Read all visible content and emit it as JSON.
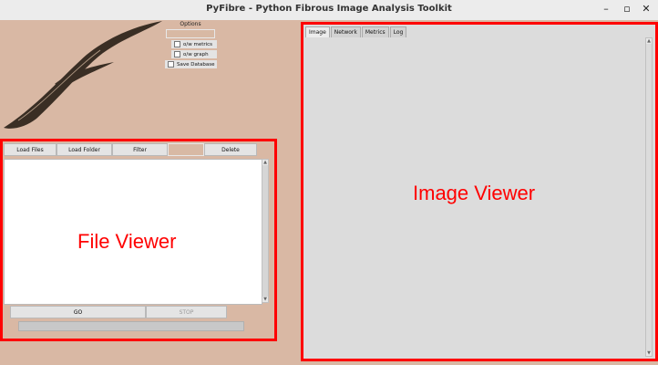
{
  "window": {
    "title": "PyFibre - Python Fibrous Image Analysis Toolkit",
    "minimize_symbol": "–",
    "maximize_symbol": "▫",
    "close_symbol": "✕"
  },
  "options": {
    "title": "Options",
    "checkboxes": [
      {
        "label": "o/w metrics",
        "checked": false
      },
      {
        "label": "o/w graph",
        "checked": false
      },
      {
        "label": "Save Database",
        "checked": false
      }
    ]
  },
  "file_panel": {
    "buttons": {
      "load_files": "Load Files",
      "load_folder": "Load Folder",
      "filter": "Filter",
      "delete": "Delete"
    },
    "filter_value": "",
    "overlay_label": "File Viewer",
    "go_label": "GO",
    "stop_label": "STOP",
    "progress": 0
  },
  "viewer": {
    "tabs": [
      "Image",
      "Network",
      "Metrics",
      "Log"
    ],
    "active_tab": "Image",
    "overlay_label": "Image Viewer"
  },
  "colors": {
    "background": "#d9b8a4",
    "highlight": "#ff0000"
  }
}
